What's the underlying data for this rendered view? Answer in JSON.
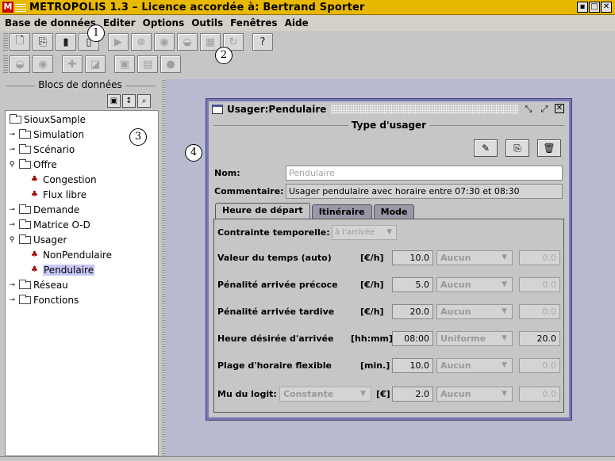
{
  "app": {
    "title": "METROPOLIS 1.3 – Licence accordée à: Bertrand Sporter",
    "logo": "M",
    "window_buttons": [
      "▪",
      "□",
      "✕"
    ]
  },
  "menu": [
    "Base de données",
    "Editer",
    "Options",
    "Outils",
    "Fenêtres",
    "Aide"
  ],
  "toolbar1": {
    "buttons": [
      {
        "icon": "new-doc-icon",
        "glyph": "🗋",
        "enabled": true
      },
      {
        "icon": "copy-icon",
        "glyph": "⎘",
        "enabled": true
      },
      {
        "icon": "delete-icon",
        "glyph": "▮",
        "enabled": true
      },
      {
        "icon": "paste-icon",
        "glyph": "▯",
        "enabled": true
      },
      {
        "icon": "play-icon",
        "glyph": "▶",
        "enabled": false
      },
      {
        "icon": "stop-icon",
        "glyph": "⊗",
        "enabled": false
      },
      {
        "icon": "eye-icon",
        "glyph": "◉",
        "enabled": false
      },
      {
        "icon": "binoculars-icon",
        "glyph": "◒",
        "enabled": false
      },
      {
        "icon": "chart-icon",
        "glyph": "▦",
        "enabled": false
      },
      {
        "icon": "refresh-icon",
        "glyph": "↻",
        "enabled": false
      },
      {
        "icon": "help-icon",
        "glyph": "?",
        "enabled": true
      }
    ]
  },
  "toolbar2": {
    "buttons": [
      {
        "icon": "binoculars-icon",
        "glyph": "◒",
        "enabled": false
      },
      {
        "icon": "eye-icon",
        "glyph": "◉",
        "enabled": false
      },
      {
        "icon": "figure-icon",
        "glyph": "✚",
        "enabled": false
      },
      {
        "icon": "area-icon",
        "glyph": "◪",
        "enabled": false
      },
      {
        "icon": "grid-icon",
        "glyph": "▣",
        "enabled": false
      },
      {
        "icon": "table-icon",
        "glyph": "▤",
        "enabled": false
      },
      {
        "icon": "record-icon",
        "glyph": "●",
        "enabled": false
      }
    ]
  },
  "callouts": [
    "1",
    "2",
    "3",
    "4"
  ],
  "left_panel": {
    "title": "Blocs de données",
    "tree": [
      {
        "label": "SiouxSample",
        "level": 0,
        "type": "folder",
        "expander": ""
      },
      {
        "label": "Simulation",
        "level": 0,
        "type": "folder",
        "expander": "o-"
      },
      {
        "label": "Scénario",
        "level": 0,
        "type": "folder",
        "expander": "o-"
      },
      {
        "label": "Offre",
        "level": 0,
        "type": "folder",
        "expander": "o|"
      },
      {
        "label": "Congestion",
        "level": 1,
        "type": "leaf",
        "expander": ""
      },
      {
        "label": "Flux libre",
        "level": 1,
        "type": "leaf",
        "expander": ""
      },
      {
        "label": "Demande",
        "level": 0,
        "type": "folder",
        "expander": "o-"
      },
      {
        "label": "Matrice O-D",
        "level": 0,
        "type": "folder",
        "expander": "o-"
      },
      {
        "label": "Usager",
        "level": 0,
        "type": "folder",
        "expander": "o|"
      },
      {
        "label": "NonPendulaire",
        "level": 1,
        "type": "leaf",
        "expander": ""
      },
      {
        "label": "Pendulaire",
        "level": 1,
        "type": "leaf",
        "expander": "",
        "selected": true
      },
      {
        "label": "Réseau",
        "level": 0,
        "type": "folder",
        "expander": "o-"
      },
      {
        "label": "Fonctions",
        "level": 0,
        "type": "folder",
        "expander": "o-"
      }
    ]
  },
  "frame": {
    "title": "Usager:Pendulaire",
    "section_title": "Type d'usager",
    "name_label": "Nom:",
    "name_value": "Pendulaire",
    "comment_label": "Commentaire:",
    "comment_value": "Usager pendulaire avec horaire entre 07:30 et 08:30",
    "tabs": [
      "Heure de départ",
      "Itinéraire",
      "Mode"
    ],
    "contrainte_label": "Contrainte temporelle:",
    "contrainte_value": "à l'arrivée",
    "params": [
      {
        "label": "Valeur du temps (auto)",
        "unit": "[€/h]",
        "value": "10.0",
        "dist": "Aucun",
        "dist_active": false,
        "extra": "0.0"
      },
      {
        "label": "Pénalité arrivée précoce",
        "unit": "[€/h]",
        "value": "5.0",
        "dist": "Aucun",
        "dist_active": false,
        "extra": "0.0"
      },
      {
        "label": "Pénalité arrivée tardive",
        "unit": "[€/h]",
        "value": "20.0",
        "dist": "Aucun",
        "dist_active": false,
        "extra": "0.0"
      },
      {
        "label": "Heure désirée d'arrivée",
        "unit": "[hh:mm]",
        "value": "08:00",
        "dist": "Uniforme",
        "dist_active": true,
        "extra": "20.0"
      },
      {
        "label": "Plage d'horaire flexible",
        "unit": "[min.]",
        "value": "10.0",
        "dist": "Aucun",
        "dist_active": false,
        "extra": "0.0"
      }
    ],
    "mu": {
      "label": "Mu du logit:",
      "combo": "Constante",
      "unit": "[€]",
      "value": "2.0",
      "dist": "Aucun",
      "extra": "0.0"
    }
  }
}
